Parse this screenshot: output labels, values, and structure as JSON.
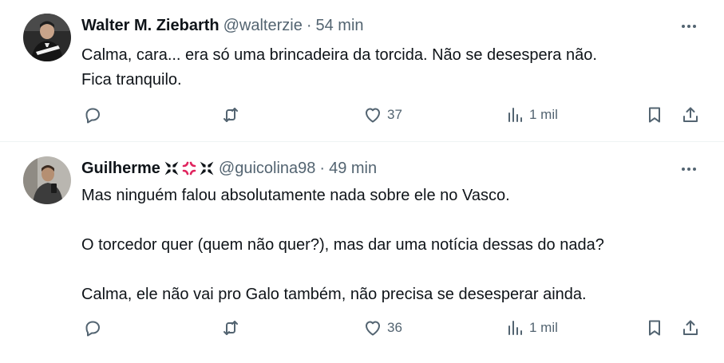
{
  "posts": [
    {
      "display_name": "Walter M. Ziebarth",
      "handle": "@walterzie",
      "separator": "·",
      "time": "54 min",
      "paragraphs": [
        "Calma, cara... era só uma brincadeira da torcida. Não se desespera não.",
        "Fica tranquilo."
      ],
      "likes": "37",
      "views": "1 mil",
      "avatar_icon": "profile-photo"
    },
    {
      "display_name": "Guilherme",
      "name_emojis": [
        "✠",
        "💢",
        "✠"
      ],
      "handle": "@guicolina98",
      "separator": "·",
      "time": "49 min",
      "paragraphs": [
        "Mas ninguém falou absolutamente nada sobre ele no Vasco.",
        "O torcedor quer (quem não quer?), mas dar uma notícia dessas do nada?",
        "Calma, ele não vai pro Galo também, não precisa se desesperar ainda."
      ],
      "likes": "36",
      "views": "1 mil",
      "avatar_icon": "profile-photo"
    }
  ],
  "icons": {
    "more": "more-horizontal-icon",
    "reply": "reply-icon",
    "retweet": "retweet-icon",
    "like": "heart-icon",
    "views": "views-bar-chart-icon",
    "bookmark": "bookmark-icon",
    "share": "share-icon"
  },
  "colors": {
    "text": "#0f1419",
    "secondary": "#536471",
    "divider": "#eff3f4",
    "emoji_red": "#e0245e"
  }
}
